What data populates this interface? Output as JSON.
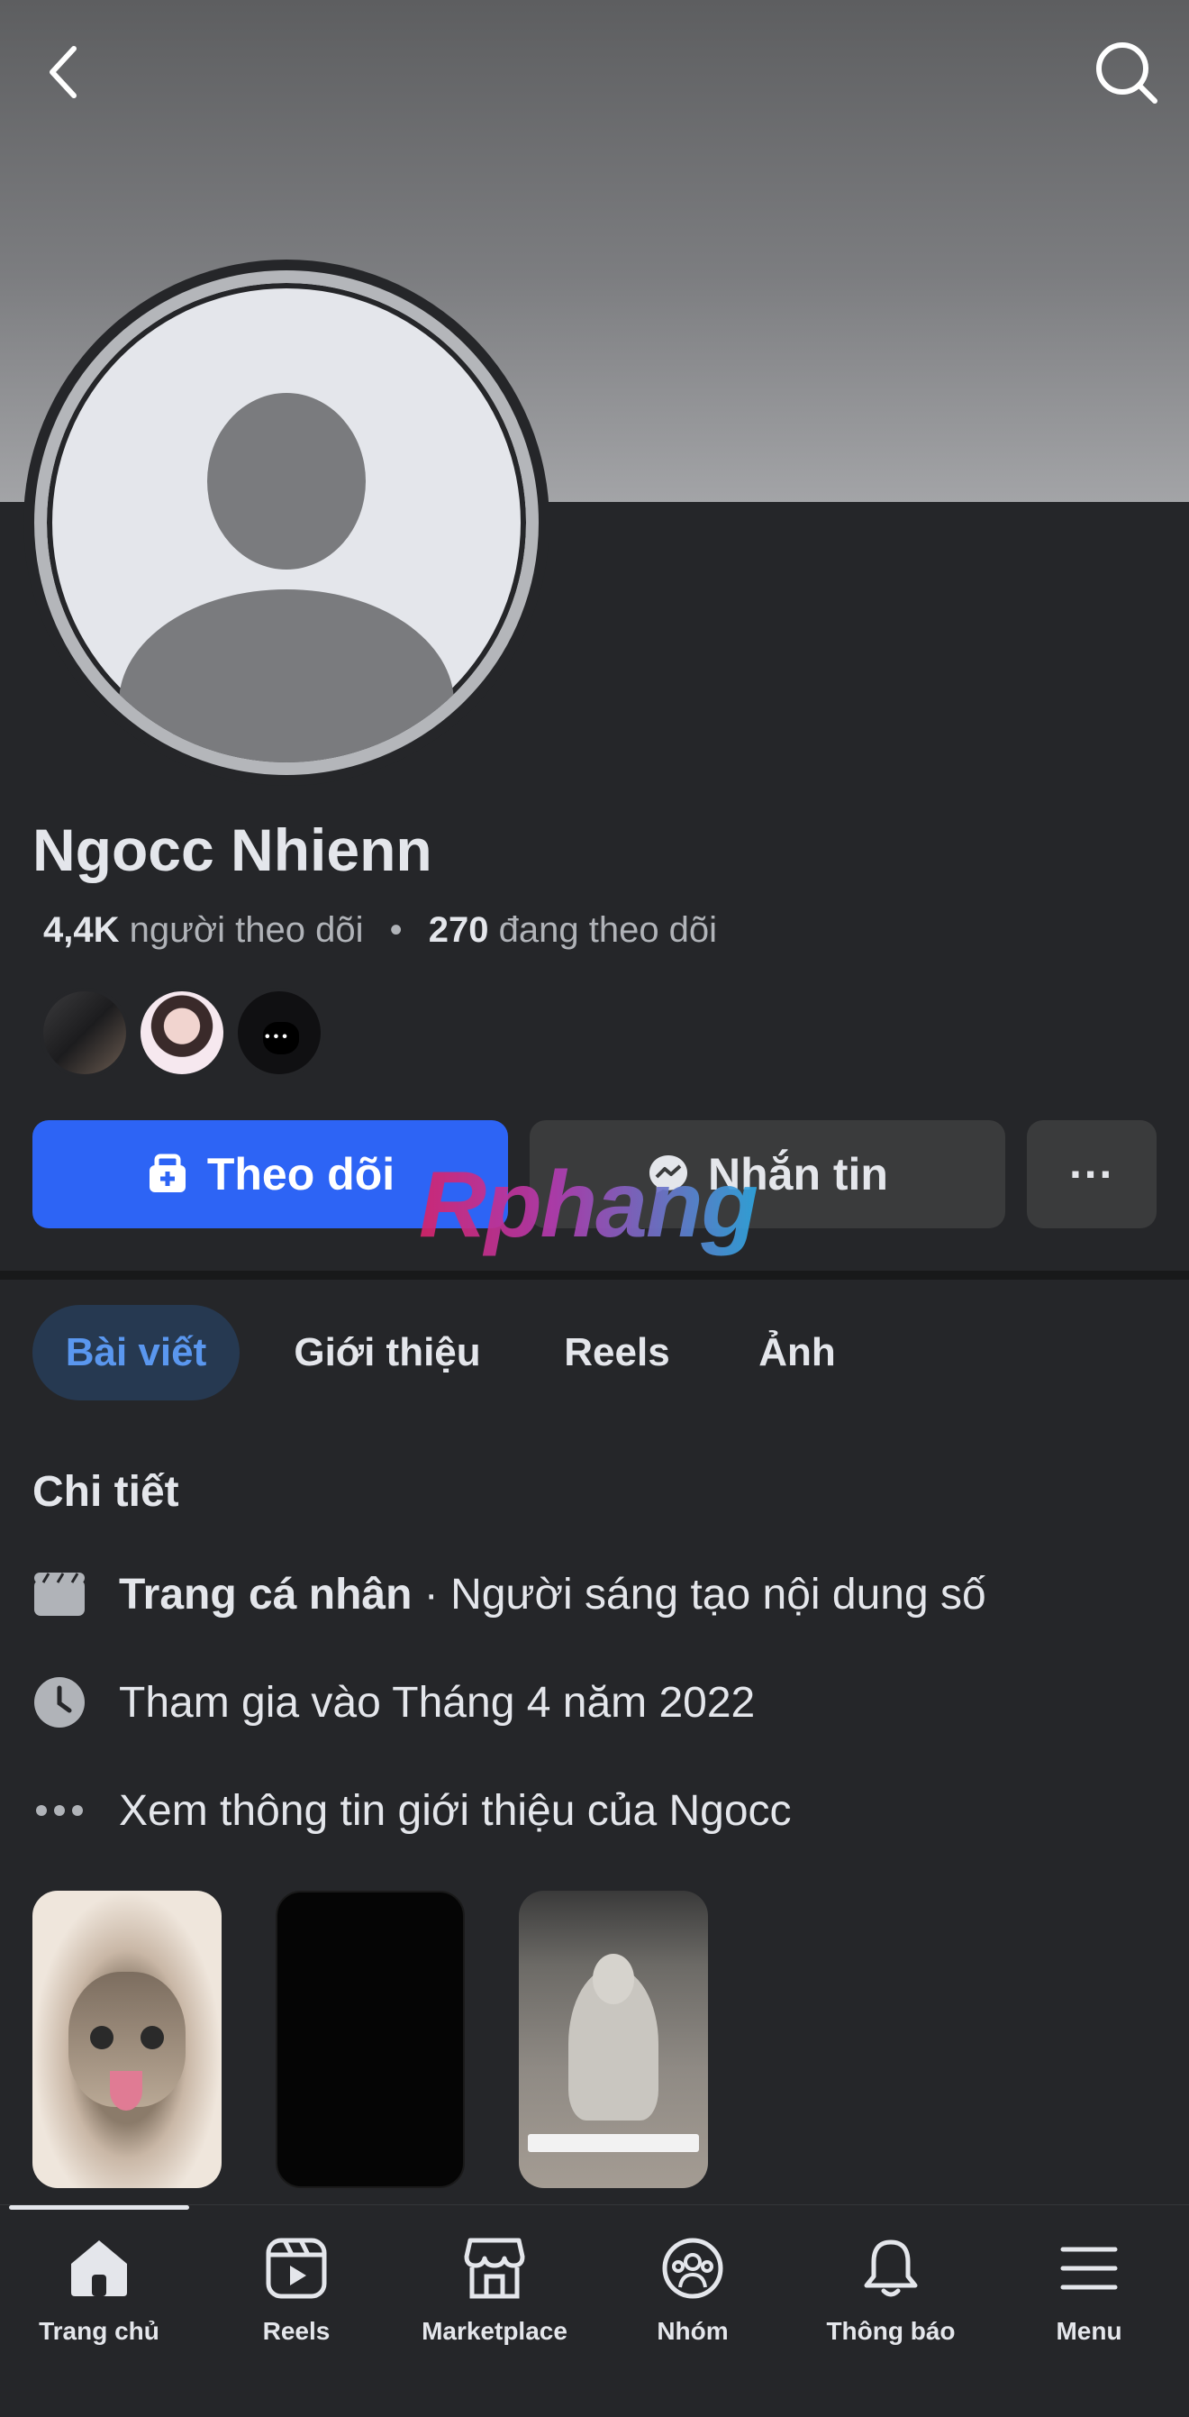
{
  "profile": {
    "name": "Ngocc Nhienn",
    "followers_count": "4,4K",
    "followers_label": "người theo dõi",
    "following_count": "270",
    "following_label": "đang theo dõi",
    "separator": "•"
  },
  "actions": {
    "follow_label": "Theo dõi",
    "message_label": "Nhắn tin",
    "more_label": "···"
  },
  "watermark": "Rphang",
  "tabs": [
    {
      "label": "Bài viết",
      "active": true
    },
    {
      "label": "Giới thiệu",
      "active": false
    },
    {
      "label": "Reels",
      "active": false
    },
    {
      "label": "Ảnh",
      "active": false
    }
  ],
  "details": {
    "title": "Chi tiết",
    "page_type_label": "Trang cá nhân",
    "page_type_value": " · Người sáng tạo nội dung số",
    "joined": "Tham gia vào Tháng 4 năm 2022",
    "see_more": "Xem thông tin giới thiệu của Ngocc"
  },
  "bottom_nav": [
    {
      "label": "Trang chủ",
      "icon": "home-icon",
      "active": true
    },
    {
      "label": "Reels",
      "icon": "reels-icon",
      "active": false
    },
    {
      "label": "Marketplace",
      "icon": "marketplace-icon",
      "active": false
    },
    {
      "label": "Nhóm",
      "icon": "groups-icon",
      "active": false
    },
    {
      "label": "Thông báo",
      "icon": "bell-icon",
      "active": false
    },
    {
      "label": "Menu",
      "icon": "menu-icon",
      "active": false
    }
  ],
  "colors": {
    "background": "#252629",
    "primary": "#2d64f5",
    "secondary_button": "#3a3b3c",
    "active_tab_bg": "#263951",
    "active_tab_text": "#5a97ef"
  }
}
